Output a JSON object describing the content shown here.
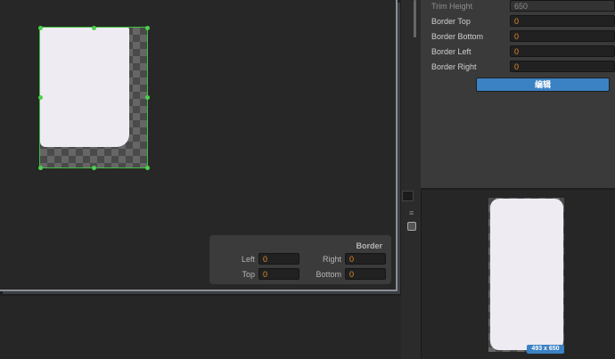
{
  "scene": {
    "border_panel": {
      "title": "Border",
      "left_label": "Left",
      "left_value": "0",
      "right_label": "Right",
      "right_value": "0",
      "top_label": "Top",
      "top_value": "0",
      "bottom_label": "Bottom",
      "bottom_value": "0"
    }
  },
  "inspector": {
    "trim_height_label": "Trim Height",
    "trim_height_value": "650",
    "fields": [
      {
        "label": "Border Top",
        "value": "0"
      },
      {
        "label": "Border Bottom",
        "value": "0"
      },
      {
        "label": "Border Left",
        "value": "0"
      },
      {
        "label": "Border Right",
        "value": "0"
      }
    ],
    "edit_button": "编辑"
  },
  "preview": {
    "size_badge": "493 x 650"
  },
  "colors": {
    "accent": "#3b82c4",
    "value": "#e08a2a",
    "handle": "#4cd04c"
  }
}
